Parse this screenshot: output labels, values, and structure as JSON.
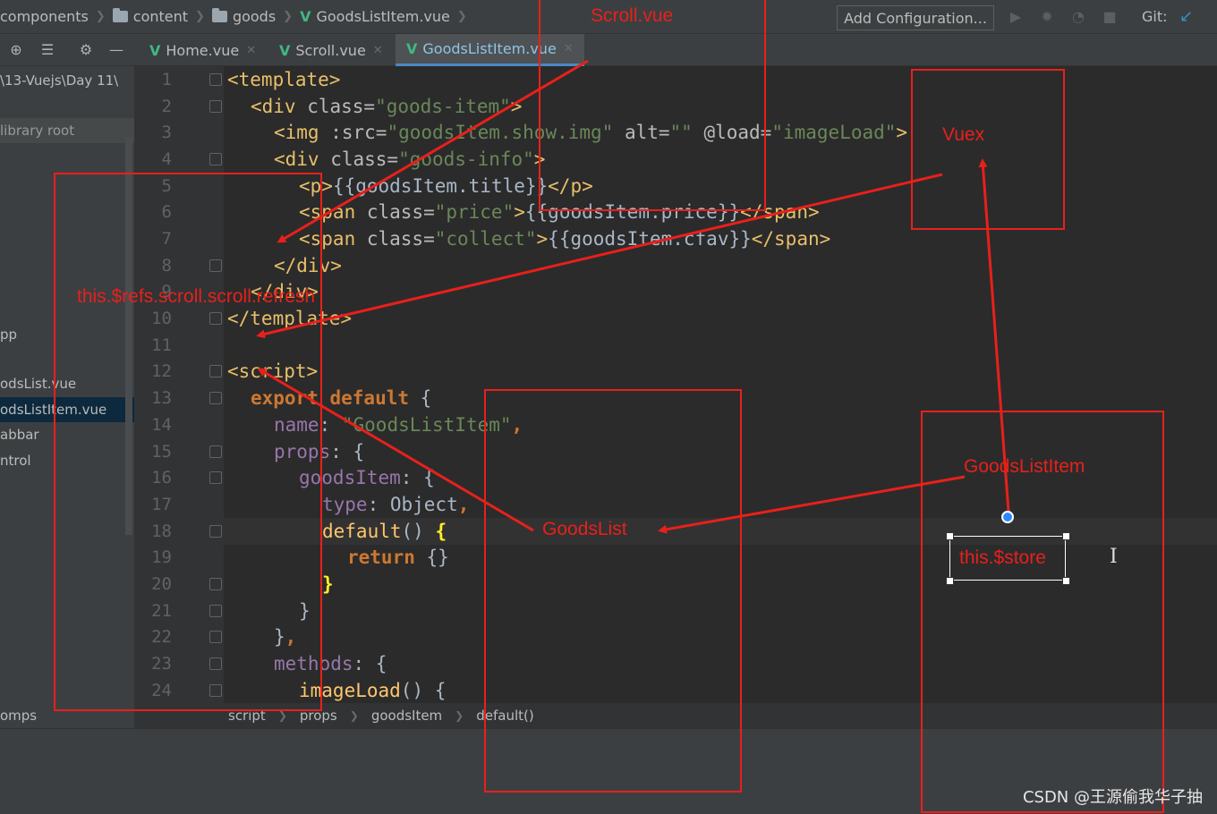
{
  "breadcrumb": {
    "items": [
      "components",
      "content",
      "goods",
      "GoodsListItem.vue"
    ]
  },
  "toolbar": {
    "add_config_label": "Add Configuration...",
    "git_label": "Git:"
  },
  "tabs": [
    {
      "label": "Home.vue",
      "active": false
    },
    {
      "label": "Scroll.vue",
      "active": false
    },
    {
      "label": "GoodsListItem.vue",
      "active": true
    }
  ],
  "project_panel": {
    "path": "\\13-Vuejs\\Day 11\\",
    "library_root": "library root",
    "items": [
      "pp",
      "odsList.vue",
      "odsListItem.vue",
      "abbar",
      "ntrol"
    ],
    "bottom": "omps"
  },
  "editor": {
    "line_numbers": [
      "1",
      "2",
      "3",
      "4",
      "5",
      "6",
      "7",
      "8",
      "9",
      "10",
      "11",
      "12",
      "13",
      "14",
      "15",
      "16",
      "17",
      "18",
      "19",
      "20",
      "21",
      "22",
      "23",
      "24"
    ]
  },
  "bottom_breadcrumb": [
    "script",
    "props",
    "goodsItem",
    "default()"
  ],
  "annotations": {
    "scroll_vue": "Scroll.vue",
    "vuex": "Vuex",
    "scroll_refresh": "this.$refs.scroll.scroll.refresh",
    "goods_list": "GoodsList",
    "goods_list_item": "GoodsListItem",
    "store": "this.$store"
  },
  "watermark": "CSDN @王源偷我华子抽",
  "colors": {
    "annotation_red": "#e8201b",
    "vue_green": "#41b883",
    "active_tab_text": "#8fc3e4"
  }
}
